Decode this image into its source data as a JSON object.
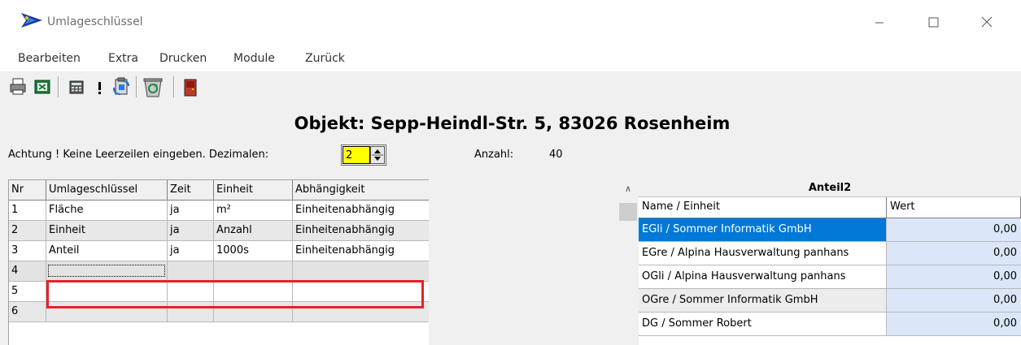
{
  "window": {
    "title": "Umlageschlüssel",
    "controls": {
      "minimize": "—",
      "maximize": "☐",
      "close": "✕"
    }
  },
  "menu": [
    "Bearbeiten",
    "Extra",
    "Drucken",
    "Module",
    "Zurück"
  ],
  "toolbar": {
    "buttons": [
      "printer-icon",
      "excel-icon",
      "calculator-icon",
      "exclamation-icon",
      "clipboard-swap-icon",
      "recycle-bin-icon",
      "exit-door-icon"
    ]
  },
  "object_title": "Objekt: Sepp-Heindl-Str. 5, 83026 Rosenheim",
  "settings": {
    "hint": "Achtung ! Keine Leerzeilen eingeben.  Dezimalen:",
    "decimals": "2",
    "anzahl_label": "Anzahl:",
    "anzahl_value": "40"
  },
  "left_table": {
    "headers": [
      "Nr",
      "Umlageschlüssel",
      "Zeit",
      "Einheit",
      "Abhängigkeit"
    ],
    "rows": [
      [
        "1",
        "Fläche",
        "ja",
        "m²",
        "Einheitenabhängig"
      ],
      [
        "2",
        "Einheit",
        "ja",
        "Anzahl",
        "Einheitenabhängig"
      ],
      [
        "3",
        "Anteil",
        "ja",
        "1000s",
        "Einheitenabhängig"
      ],
      [
        "4",
        "",
        "",
        "",
        ""
      ],
      [
        "5",
        "",
        "",
        "",
        ""
      ],
      [
        "6",
        "",
        "",
        "",
        ""
      ]
    ]
  },
  "right_table": {
    "title": "Anteil2",
    "headers": [
      "Name / Einheit",
      "Wert"
    ],
    "scroll_up": "∧",
    "rows": [
      [
        "EGli / Sommer Informatik GmbH",
        "0,00"
      ],
      [
        "EGre / Alpina Hausverwaltung panhans",
        "0,00"
      ],
      [
        "OGli / Alpina Hausverwaltung panhans",
        "0,00"
      ],
      [
        "OGre / Sommer Informatik GmbH",
        "0,00"
      ],
      [
        "DG / Sommer Robert",
        "0,00"
      ]
    ]
  },
  "colors": {
    "selection": "#0078d7",
    "decimal_highlight": "#ffff00",
    "annotation": "#e0242a",
    "value_cell": "#dbe6f8"
  }
}
